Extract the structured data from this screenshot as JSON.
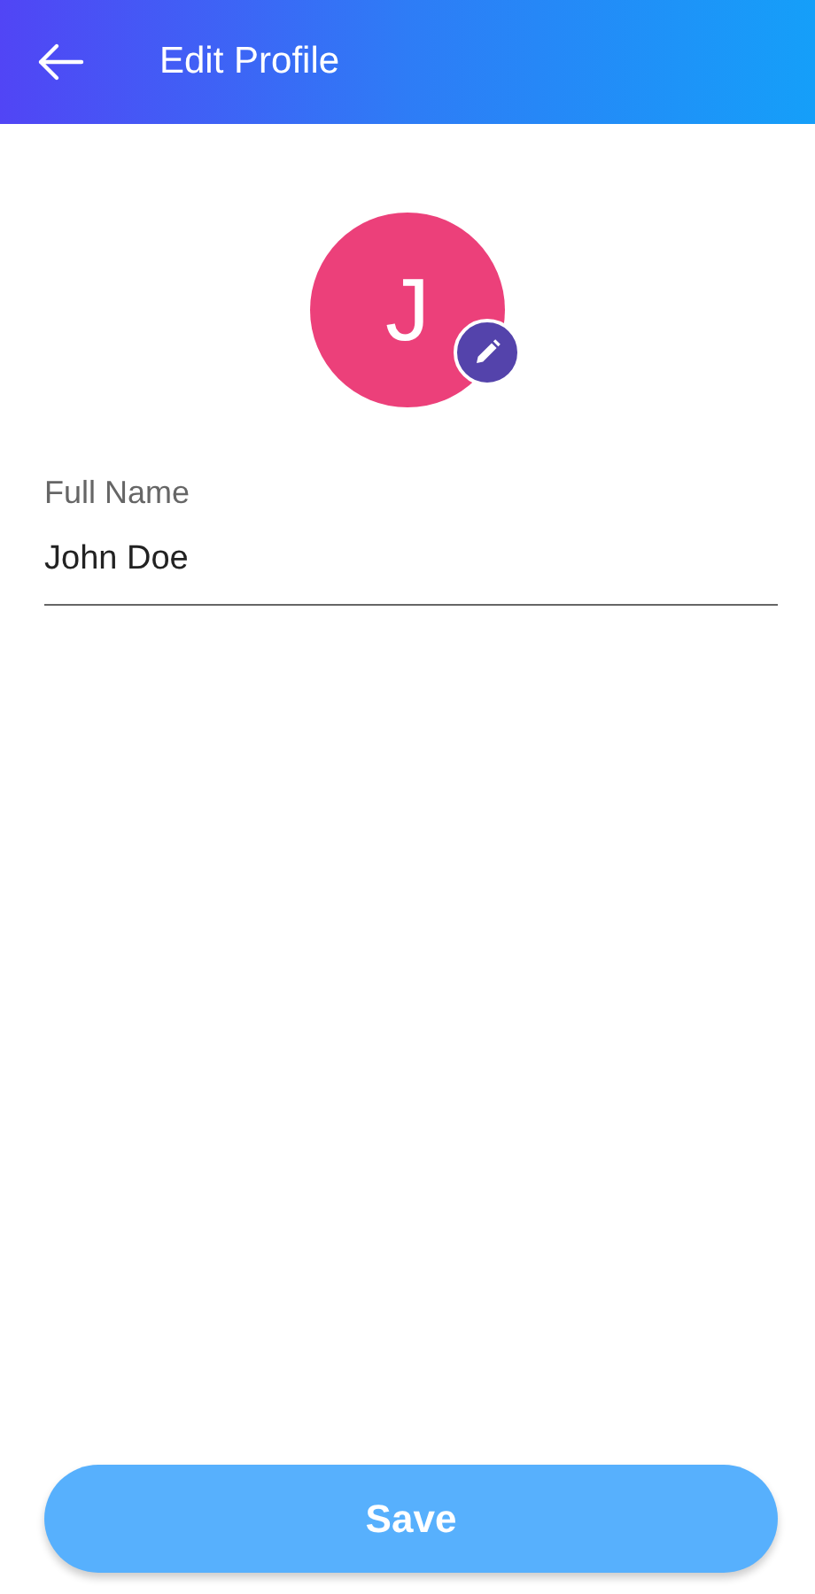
{
  "header": {
    "title": "Edit Profile"
  },
  "avatar": {
    "initial": "J",
    "color": "#ec407a"
  },
  "fields": [
    {
      "label": "Full Name",
      "value": "John Doe"
    }
  ],
  "buttons": [
    "Save"
  ]
}
